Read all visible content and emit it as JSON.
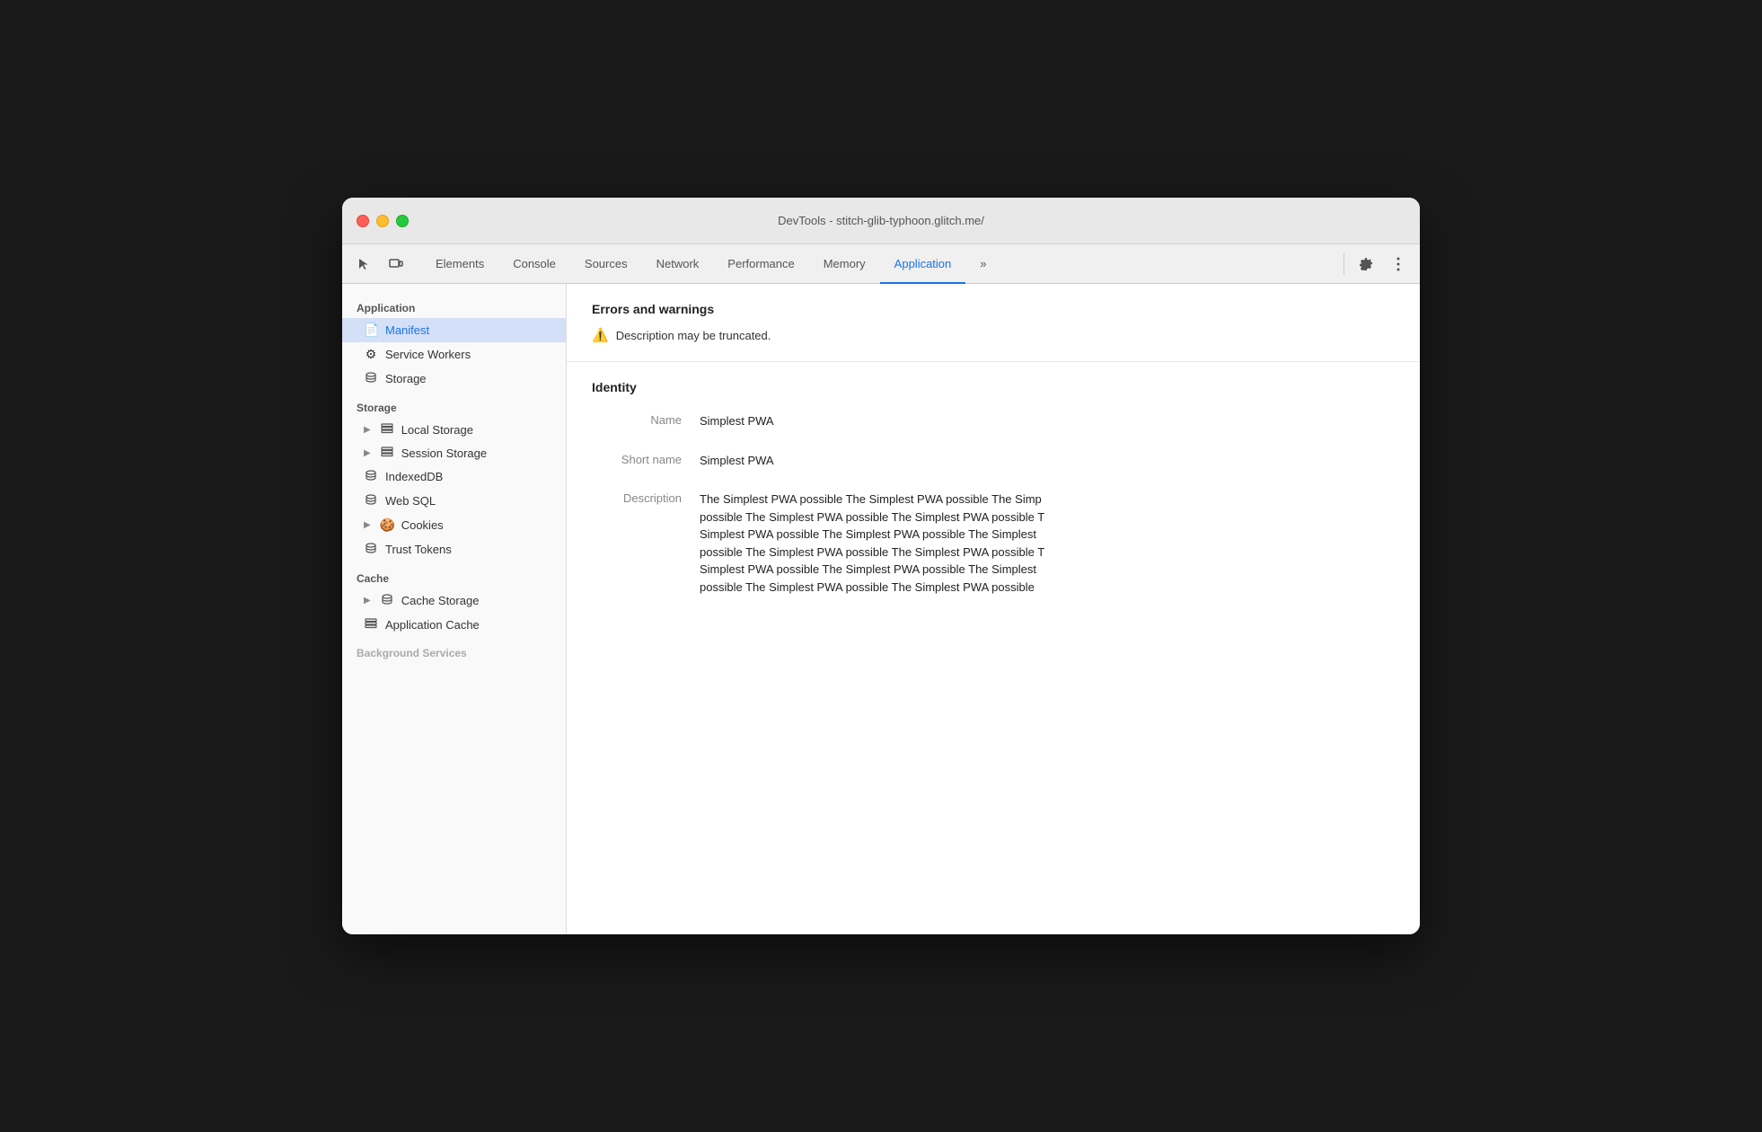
{
  "window": {
    "title": "DevTools - stitch-glib-typhoon.glitch.me/"
  },
  "toolbar": {
    "tabs": [
      {
        "label": "Elements",
        "active": false
      },
      {
        "label": "Console",
        "active": false
      },
      {
        "label": "Sources",
        "active": false
      },
      {
        "label": "Network",
        "active": false
      },
      {
        "label": "Performance",
        "active": false
      },
      {
        "label": "Memory",
        "active": false
      },
      {
        "label": "Application",
        "active": true
      }
    ],
    "more_tabs_label": "»",
    "settings_title": "Settings",
    "more_options_title": "More options"
  },
  "sidebar": {
    "section_application": "Application",
    "section_storage": "Storage",
    "section_cache": "Cache",
    "section_background": "Background Services",
    "items_application": [
      {
        "label": "Manifest",
        "icon": "📄",
        "active": true
      },
      {
        "label": "Service Workers",
        "icon": "⚙️",
        "active": false
      },
      {
        "label": "Storage",
        "icon": "🗄️",
        "active": false
      }
    ],
    "items_storage": [
      {
        "label": "Local Storage",
        "icon": "▦",
        "has_arrow": true
      },
      {
        "label": "Session Storage",
        "icon": "▦",
        "has_arrow": true
      },
      {
        "label": "IndexedDB",
        "icon": "🗄️",
        "has_arrow": false
      },
      {
        "label": "Web SQL",
        "icon": "🗄️",
        "has_arrow": false
      },
      {
        "label": "Cookies",
        "icon": "🍪",
        "has_arrow": true
      },
      {
        "label": "Trust Tokens",
        "icon": "🗄️",
        "has_arrow": false
      }
    ],
    "items_cache": [
      {
        "label": "Cache Storage",
        "icon": "🗄️",
        "has_arrow": true
      },
      {
        "label": "Application Cache",
        "icon": "▦",
        "has_arrow": false
      }
    ]
  },
  "content": {
    "errors_section": {
      "title": "Errors and warnings",
      "warning_text": "Description may be truncated."
    },
    "identity_section": {
      "title": "Identity",
      "fields": [
        {
          "label": "Name",
          "value": "Simplest PWA"
        },
        {
          "label": "Short name",
          "value": "Simplest PWA"
        },
        {
          "label": "Description",
          "value": "The Simplest PWA possible The Simplest PWA possible The Simp\npossible The Simplest PWA possible The Simplest PWA possible T\nSimplest PWA possible The Simplest PWA possible The Simplest\npossible The Simplest PWA possible The Simplest PWA possible T\nSimplest PWA possible The Simplest PWA possible The Simplest\npossible The Simplest PWA possible The Simplest PWA possible"
        }
      ]
    }
  }
}
